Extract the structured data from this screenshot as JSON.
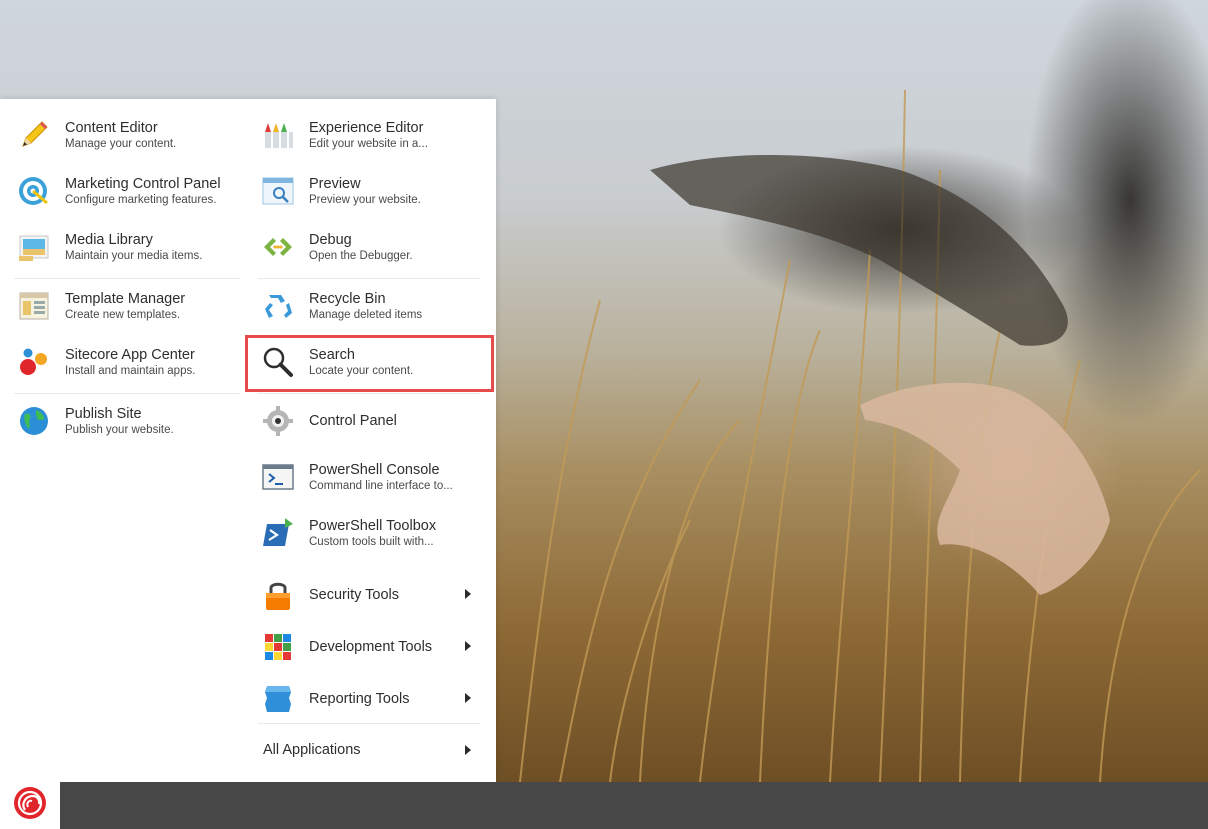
{
  "menu": {
    "left": [
      {
        "title": "Content Editor",
        "subtitle": "Manage your content.",
        "icon": "pencil-icon"
      },
      {
        "title": "Marketing Control Panel",
        "subtitle": "Configure marketing features.",
        "icon": "target-icon"
      },
      {
        "title": "Media Library",
        "subtitle": "Maintain your media items.",
        "icon": "image-icon"
      },
      {
        "title": "Template Manager",
        "subtitle": "Create new templates.",
        "icon": "template-icon"
      },
      {
        "title": "Sitecore App Center",
        "subtitle": "Install and maintain apps.",
        "icon": "app-center-icon"
      },
      {
        "title": "Publish Site",
        "subtitle": "Publish your website.",
        "icon": "globe-icon"
      }
    ],
    "right": [
      {
        "title": "Experience Editor",
        "subtitle": "Edit your website in a...",
        "icon": "crayons-icon"
      },
      {
        "title": "Preview",
        "subtitle": "Preview your website.",
        "icon": "preview-icon"
      },
      {
        "title": "Debug",
        "subtitle": "Open the Debugger.",
        "icon": "debug-icon"
      },
      {
        "title": "Recycle Bin",
        "subtitle": "Manage deleted items",
        "icon": "recycle-icon"
      },
      {
        "title": "Search",
        "subtitle": "Locate your content.",
        "icon": "search-icon"
      },
      {
        "title": "Control Panel",
        "subtitle": "",
        "icon": "gear-icon"
      },
      {
        "title": "PowerShell Console",
        "subtitle": "Command line interface to...",
        "icon": "console-icon"
      },
      {
        "title": "PowerShell Toolbox",
        "subtitle": "Custom tools built with...",
        "icon": "powershell-icon"
      },
      {
        "title": "Security Tools",
        "subtitle": "",
        "icon": "lock-icon"
      },
      {
        "title": "Development Tools",
        "subtitle": "",
        "icon": "cube-icon"
      },
      {
        "title": "Reporting Tools",
        "subtitle": "",
        "icon": "reporting-icon"
      }
    ],
    "all_applications": "All Applications"
  },
  "taskbar": {
    "start_icon": "sitecore-logo-icon"
  },
  "colors": {
    "highlight": "#e84b4b",
    "taskbar": "#474747",
    "menu_bg": "#ffffff"
  }
}
